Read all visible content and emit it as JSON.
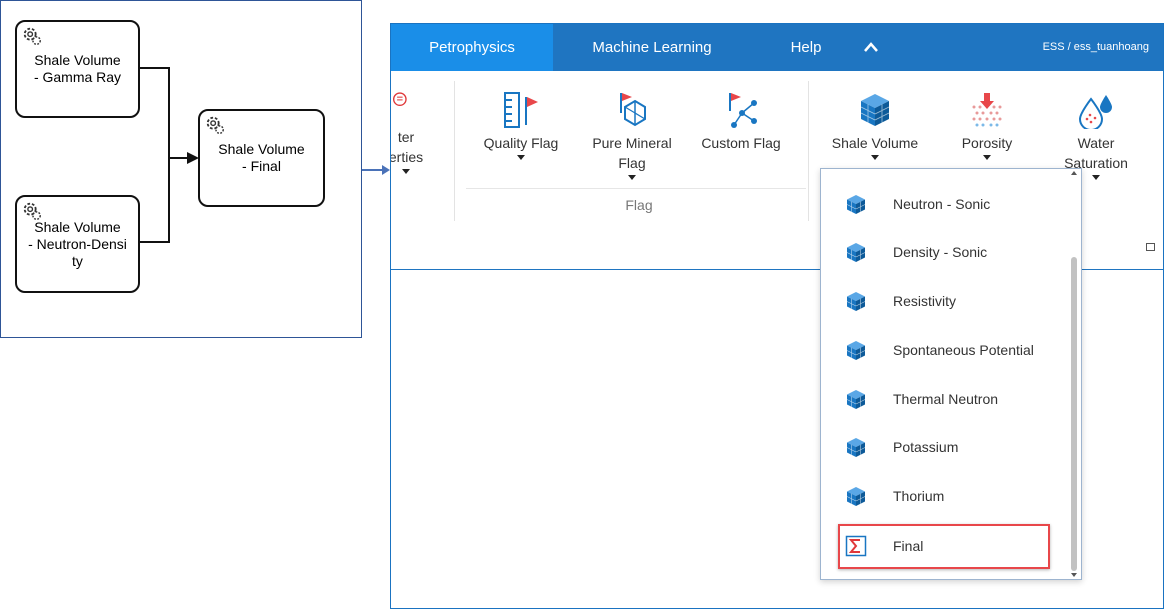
{
  "diagram": {
    "nodes": {
      "gamma": "Shale Volume\n- Gamma Ray",
      "neutron_density": "Shale Volume\n- Neutron-Densi\nty",
      "final": "Shale Volume\n- Final"
    }
  },
  "app": {
    "menu": {
      "tabs": [
        "Petrophysics",
        "Machine Learning",
        "Help"
      ],
      "active_tab": "Petrophysics",
      "user": "ESS / ess_tuanhoang"
    },
    "ribbon": {
      "partial_button": "ter\nerties",
      "buttons": {
        "quality_flag": "Quality Flag",
        "pure_mineral_flag": "Pure Mineral\nFlag",
        "custom_flag": "Custom Flag",
        "shale_volume": "Shale Volume",
        "porosity": "Porosity",
        "water_saturation": "Water\nSaturation"
      },
      "group_flag": "Flag"
    },
    "dropdown": {
      "items": [
        "Neutron - Sonic",
        "Density - Sonic",
        "Resistivity",
        "Spontaneous Potential",
        "Thermal Neutron",
        "Potassium",
        "Thorium",
        "Final"
      ],
      "highlighted": "Final"
    }
  },
  "colors": {
    "menubar": "#1f75c1",
    "active_tab": "#1a8ee8",
    "highlight": "#e8474a",
    "cube_icon": "#1976c2"
  },
  "icons": {
    "node": "gear-icon",
    "dropdown_item": "cube-icon",
    "final_item": "sigma-icon"
  }
}
